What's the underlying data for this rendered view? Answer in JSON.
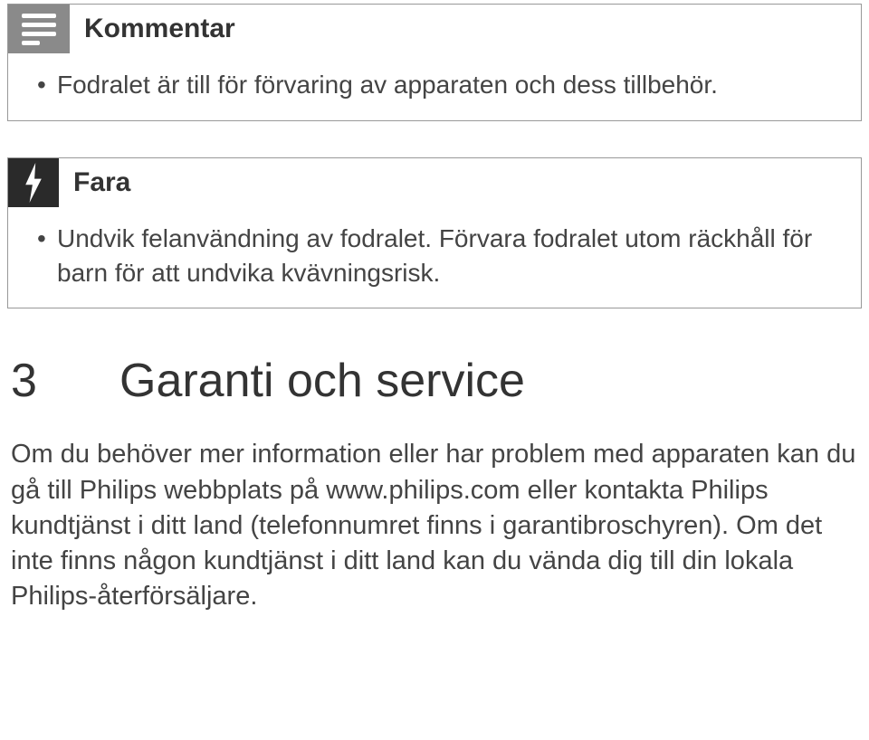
{
  "noteBox": {
    "title": "Kommentar",
    "item": "Fodralet är till för förvaring av apparaten och dess tillbehör."
  },
  "dangerBox": {
    "title": "Fara",
    "item": "Undvik felanvändning av fodralet. Förvara fodralet utom räckhåll för barn för att undvika kvävningsrisk."
  },
  "section": {
    "number": "3",
    "title": "Garanti och service",
    "body": "Om du behöver mer information eller har problem med apparaten kan du gå till Philips webbplats på www.philips.com eller kontakta Philips kundtjänst i ditt land (telefonnumret finns i garantibroschyren). Om det inte finns någon kundtjänst i ditt land kan du vända dig till din lokala Philips-återförsäljare."
  }
}
